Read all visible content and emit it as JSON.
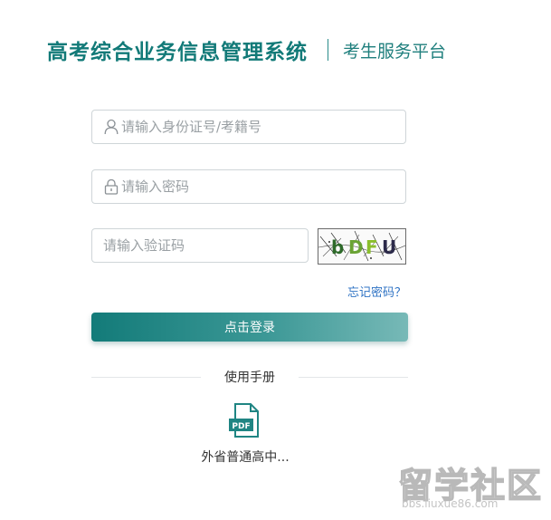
{
  "header": {
    "title": "高考综合业务信息管理系统",
    "subtitle": "考生服务平台"
  },
  "form": {
    "id_placeholder": "请输入身份证号/考籍号",
    "password_placeholder": "请输入密码",
    "captcha_placeholder": "请输入验证码",
    "captcha_text": "bDFU",
    "forgot_label": "忘记密码？",
    "login_label": "点击登录"
  },
  "manual": {
    "title": "使用手册",
    "doc_icon_text": "PDF",
    "doc_name": "外省普通高中..."
  },
  "watermark": {
    "big": "留学社区",
    "small": "bbs.liuxue86.com"
  },
  "icons": {
    "user": "user-icon",
    "lock": "lock-icon",
    "pdf": "pdf-file-icon"
  },
  "colors": {
    "brand": "#127a78",
    "link": "#2f73c4",
    "button_start": "#137b79",
    "button_end": "#77b9b7"
  }
}
